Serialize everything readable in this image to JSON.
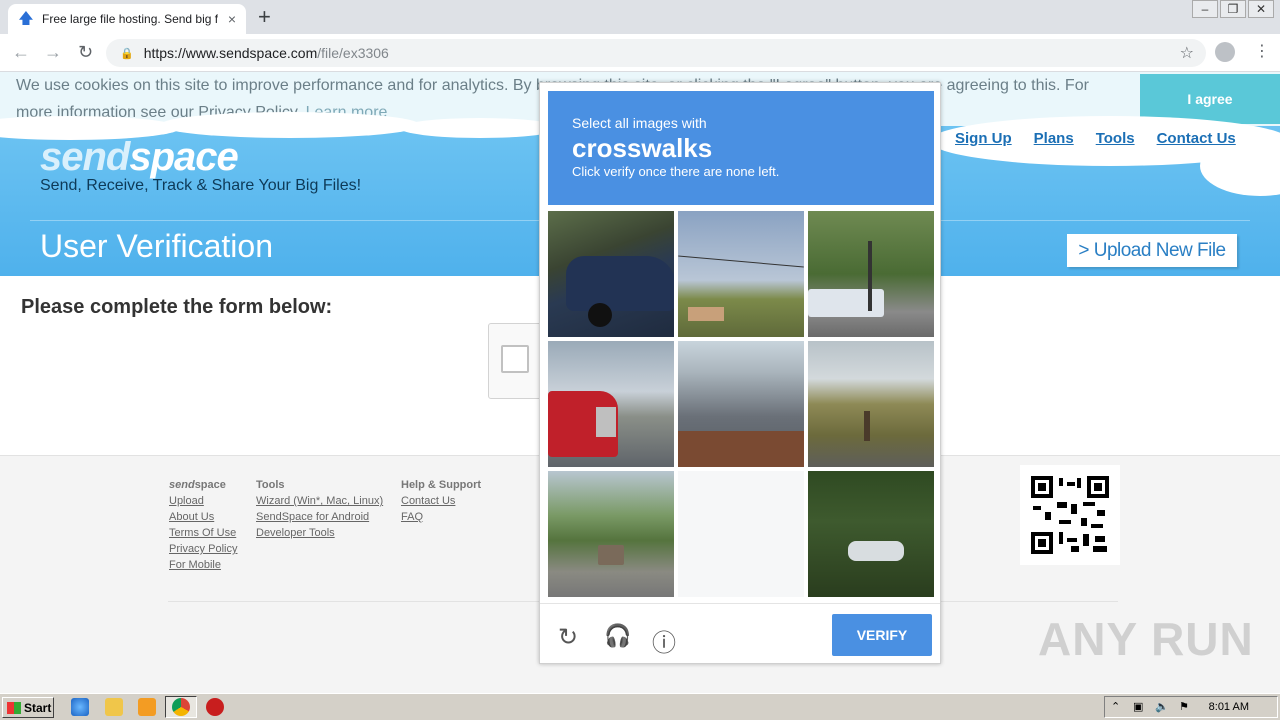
{
  "browser": {
    "tab_title": "Free large file hosting. Send big files",
    "tab_close": "×",
    "new_tab": "+",
    "url_host": "https://www.sendspace.com",
    "url_path": "/file/ex3306",
    "back": "←",
    "forward": "→",
    "reload": "↻",
    "star": "☆",
    "menu": "⋮",
    "win_min": "–",
    "win_max": "❐",
    "win_close": "✕"
  },
  "cookie": {
    "text": "We use cookies on this site to improve performance and for analytics. By browsing this site, or clicking the \"I agree\" button, you are agreeing to this. For more information see our Privacy Policy.",
    "learn_more": "Learn more",
    "agree": "I agree"
  },
  "header": {
    "logo_send": "send",
    "logo_space": "space",
    "tagline": "Send, Receive, Track & Share Your Big Files!",
    "nav": [
      "Sign Up",
      "Plans",
      "Tools",
      "Contact Us"
    ],
    "page_title": "User Verification",
    "upload_button": "> Upload New File"
  },
  "form": {
    "heading": "Please complete the form below:"
  },
  "captcha": {
    "line1": "Select all images with",
    "target": "crosswalks",
    "line3": "Click verify once there are none left.",
    "verify": "VERIFY",
    "reload_icon": "↻",
    "audio_icon": "🎧",
    "info_icon": "ⓘ"
  },
  "footer": {
    "col1": {
      "head_a": "send",
      "head_b": "space",
      "links": [
        "Upload",
        "About Us",
        "Terms Of Use",
        "Privacy Policy",
        "For Mobile"
      ]
    },
    "col2": {
      "head": "Tools",
      "links": [
        "Wizard (Win*, Mac, Linux)",
        "SendSpace for Android",
        "Developer Tools"
      ]
    },
    "col3": {
      "head": "Help & Support",
      "links": [
        "Contact Us",
        "FAQ"
      ]
    }
  },
  "watermark": "ANY RUN",
  "taskbar": {
    "start": "Start",
    "clock": "8:01 AM"
  },
  "colors": {
    "captcha_blue": "#4a90e2",
    "header_blue": "#4fb1ec",
    "agree_teal": "#5ac8d8"
  }
}
